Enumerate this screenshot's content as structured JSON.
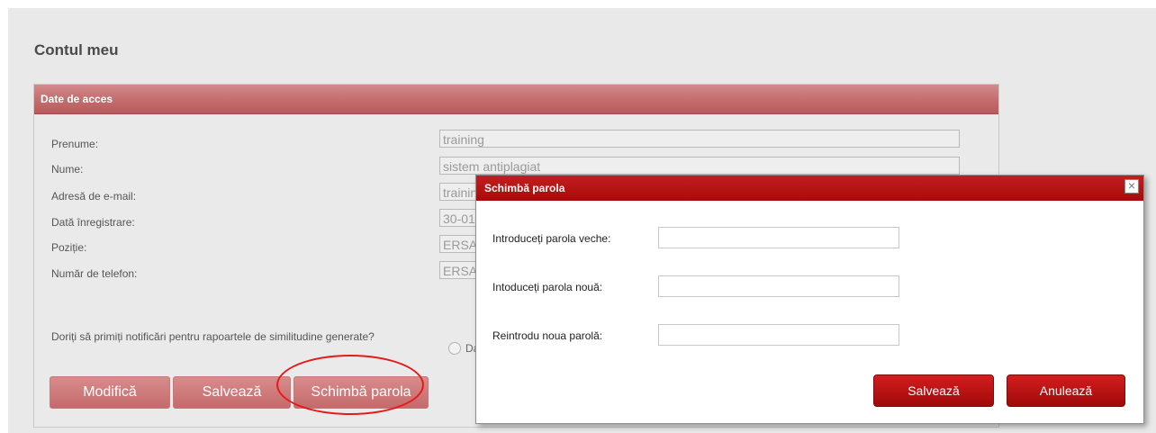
{
  "page": {
    "title": "Contul meu"
  },
  "panel": {
    "header": "Date de acces",
    "fields": [
      {
        "label": "Prenume:",
        "value": "training"
      },
      {
        "label": "Nume:",
        "value": "sistem antiplagiat"
      },
      {
        "label": "Adresă de e-mail:",
        "value": "trainin"
      },
      {
        "label": "Dată înregistrare:",
        "value": "30-01-"
      },
      {
        "label": "Poziție:",
        "value": "ERSA"
      },
      {
        "label": "Număr de telefon:",
        "value": "ERSA"
      }
    ],
    "notification_question": "Doriți să primiți notificări pentru rapoartele de similitudine generate?",
    "notification_option_da": "Da",
    "buttons": {
      "modify": "Modifică",
      "save": "Salvează",
      "change_password": "Schimbă parola"
    }
  },
  "dialog": {
    "title": "Schimbă parola",
    "close_glyph": "×",
    "labels": {
      "old_password": "Introduceți parola veche:",
      "new_password": "Intoduceți parola nouă:",
      "confirm_password": "Reintrodu noua parolă:"
    },
    "values": {
      "old_password": "",
      "new_password": "",
      "confirm_password": ""
    },
    "buttons": {
      "save": "Salvează",
      "cancel": "Anulează"
    }
  },
  "colors": {
    "panel_header": "#c56e70",
    "dialog_titlebar": "#b51212",
    "dialog_button": "#bb1414",
    "annotation_oval": "#e51a1a"
  }
}
